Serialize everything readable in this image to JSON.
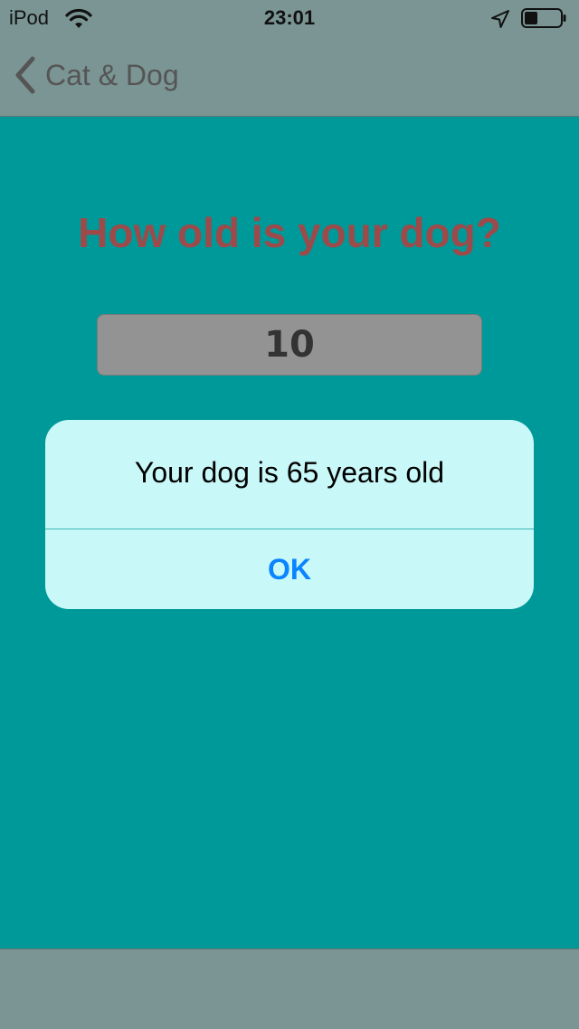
{
  "status_bar": {
    "carrier": "iPod",
    "time": "23:01",
    "icons": [
      "wifi-icon",
      "location-arrow-icon",
      "battery-icon"
    ]
  },
  "nav": {
    "back_label": "Cat & Dog",
    "back_icon": "chevron-left-icon"
  },
  "main": {
    "question": "How old is your dog?",
    "age_value": "10"
  },
  "alert": {
    "message": "Your dog is 65 years old",
    "ok_label": "OK"
  },
  "colors": {
    "background": "#009999",
    "bars": "#7a9593",
    "question_text": "#9c4a4a",
    "alert_background": "#c9f8f8",
    "alert_button": "#0a84ff"
  }
}
